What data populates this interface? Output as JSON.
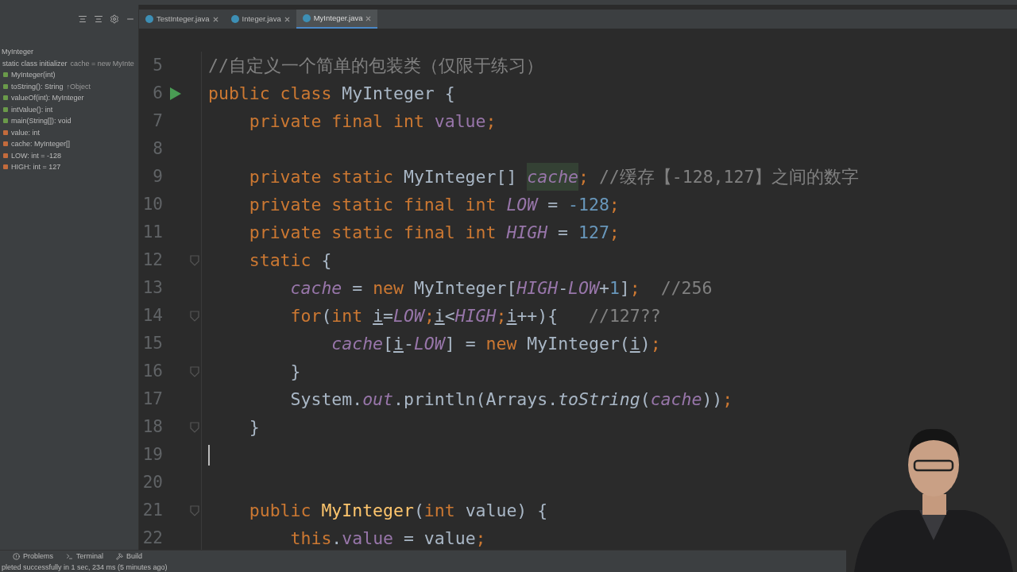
{
  "tabs": [
    {
      "label": "TestInteger.java",
      "selected": false
    },
    {
      "label": "Integer.java",
      "selected": false
    },
    {
      "label": "MyInteger.java",
      "selected": true
    }
  ],
  "structure": {
    "title": "MyInteger",
    "items": [
      {
        "kind": "initializer",
        "label": "static class initializer",
        "hint": "cache = new MyInte"
      },
      {
        "kind": "method",
        "label": "MyInteger(int)"
      },
      {
        "kind": "method",
        "label": "toString(): String",
        "hint": "↑Object"
      },
      {
        "kind": "method",
        "label": "valueOf(int): MyInteger"
      },
      {
        "kind": "method",
        "label": "intValue(): int"
      },
      {
        "kind": "method",
        "label": "main(String[]): void"
      },
      {
        "kind": "field",
        "label": "value: int"
      },
      {
        "kind": "field",
        "label": "cache: MyInteger[]"
      },
      {
        "kind": "field",
        "label": "LOW: int = -128"
      },
      {
        "kind": "field",
        "label": "HIGH: int = 127"
      }
    ]
  },
  "lines": [
    {
      "number": "5",
      "tokens": [
        {
          "kind": "comment",
          "text": "//自定义一个简单的包装类（仅限于练习）"
        }
      ]
    },
    {
      "number": "6",
      "run": true,
      "tokens": [
        {
          "kind": "keyword",
          "text": "public class "
        },
        {
          "kind": "plain",
          "text": "MyInteger {"
        }
      ]
    },
    {
      "number": "7",
      "tokens": [
        {
          "kind": "keyword",
          "text": "    private final int "
        },
        {
          "kind": "field",
          "text": "value"
        },
        {
          "kind": "keyword",
          "text": ";"
        }
      ]
    },
    {
      "number": "8"
    },
    {
      "number": "9",
      "tokens": [
        {
          "kind": "keyword",
          "text": "    private static "
        },
        {
          "kind": "plain",
          "text": "MyInteger[] "
        },
        {
          "kind": "static_field_hl",
          "text": "cache"
        },
        {
          "kind": "keyword",
          "text": "; "
        },
        {
          "kind": "comment",
          "text": "//缓存【-128,127】之间的数字"
        }
      ]
    },
    {
      "number": "10",
      "tokens": [
        {
          "kind": "keyword",
          "text": "    private static final int "
        },
        {
          "kind": "static_field",
          "text": "LOW"
        },
        {
          "kind": "plain",
          "text": " = "
        },
        {
          "kind": "number",
          "text": "-128"
        },
        {
          "kind": "keyword",
          "text": ";"
        }
      ]
    },
    {
      "number": "11",
      "tokens": [
        {
          "kind": "keyword",
          "text": "    private static final int "
        },
        {
          "kind": "static_field",
          "text": "HIGH"
        },
        {
          "kind": "plain",
          "text": " = "
        },
        {
          "kind": "number",
          "text": "127"
        },
        {
          "kind": "keyword",
          "text": ";"
        }
      ]
    },
    {
      "number": "12",
      "fold": true,
      "tokens": [
        {
          "kind": "keyword",
          "text": "    static "
        },
        {
          "kind": "plain",
          "text": "{"
        }
      ]
    },
    {
      "number": "13",
      "tokens": [
        {
          "kind": "static_field",
          "text": "        cache"
        },
        {
          "kind": "plain",
          "text": " = "
        },
        {
          "kind": "keyword",
          "text": "new "
        },
        {
          "kind": "plain",
          "text": "MyInteger["
        },
        {
          "kind": "static_field",
          "text": "HIGH"
        },
        {
          "kind": "plain",
          "text": "-"
        },
        {
          "kind": "static_field",
          "text": "LOW"
        },
        {
          "kind": "plain",
          "text": "+"
        },
        {
          "kind": "number",
          "text": "1"
        },
        {
          "kind": "plain",
          "text": "]"
        },
        {
          "kind": "keyword",
          "text": ";  "
        },
        {
          "kind": "comment",
          "text": "//256"
        }
      ]
    },
    {
      "number": "14",
      "fold": true,
      "tokens": [
        {
          "kind": "keyword",
          "text": "        for"
        },
        {
          "kind": "plain",
          "text": "("
        },
        {
          "kind": "keyword",
          "text": "int "
        },
        {
          "kind": "var",
          "text": "i"
        },
        {
          "kind": "plain",
          "text": "="
        },
        {
          "kind": "static_field",
          "text": "LOW"
        },
        {
          "kind": "keyword",
          "text": ";"
        },
        {
          "kind": "var",
          "text": "i"
        },
        {
          "kind": "plain",
          "text": "<"
        },
        {
          "kind": "static_field",
          "text": "HIGH"
        },
        {
          "kind": "keyword",
          "text": ";"
        },
        {
          "kind": "var",
          "text": "i"
        },
        {
          "kind": "plain",
          "text": "++){   "
        },
        {
          "kind": "comment",
          "text": "//127??"
        }
      ]
    },
    {
      "number": "15",
      "tokens": [
        {
          "kind": "static_field",
          "text": "            cache"
        },
        {
          "kind": "plain",
          "text": "["
        },
        {
          "kind": "var",
          "text": "i"
        },
        {
          "kind": "plain",
          "text": "-"
        },
        {
          "kind": "static_field",
          "text": "LOW"
        },
        {
          "kind": "plain",
          "text": "] = "
        },
        {
          "kind": "keyword",
          "text": "new "
        },
        {
          "kind": "plain",
          "text": "MyInteger("
        },
        {
          "kind": "var",
          "text": "i"
        },
        {
          "kind": "plain",
          "text": ")"
        },
        {
          "kind": "keyword",
          "text": ";"
        }
      ]
    },
    {
      "number": "16",
      "fold": true,
      "tokens": [
        {
          "kind": "plain",
          "text": "        }"
        }
      ]
    },
    {
      "number": "17",
      "tokens": [
        {
          "kind": "plain",
          "text": "        System."
        },
        {
          "kind": "static_field",
          "text": "out"
        },
        {
          "kind": "plain",
          "text": ".println(Arrays."
        },
        {
          "kind": "static_method",
          "text": "toString"
        },
        {
          "kind": "plain",
          "text": "("
        },
        {
          "kind": "static_field",
          "text": "cache"
        },
        {
          "kind": "plain",
          "text": "))"
        },
        {
          "kind": "keyword",
          "text": ";"
        }
      ]
    },
    {
      "number": "18",
      "fold": true,
      "tokens": [
        {
          "kind": "plain",
          "text": "    }"
        }
      ]
    },
    {
      "number": "19",
      "current": true
    },
    {
      "number": "20"
    },
    {
      "number": "21",
      "fold": true,
      "tokens": [
        {
          "kind": "keyword",
          "text": "    public "
        },
        {
          "kind": "method",
          "text": "MyInteger"
        },
        {
          "kind": "plain",
          "text": "("
        },
        {
          "kind": "keyword",
          "text": "int "
        },
        {
          "kind": "plain",
          "text": "value) {"
        }
      ]
    },
    {
      "number": "22",
      "tokens": [
        {
          "kind": "keyword",
          "text": "        this"
        },
        {
          "kind": "plain",
          "text": "."
        },
        {
          "kind": "field",
          "text": "value"
        },
        {
          "kind": "plain",
          "text": " = value"
        },
        {
          "kind": "keyword",
          "text": ";"
        }
      ]
    }
  ],
  "tool_tabs": [
    "Problems",
    "Terminal",
    "Build"
  ],
  "status": "pleted successfully in 1 sec, 234 ms (5 minutes ago)"
}
